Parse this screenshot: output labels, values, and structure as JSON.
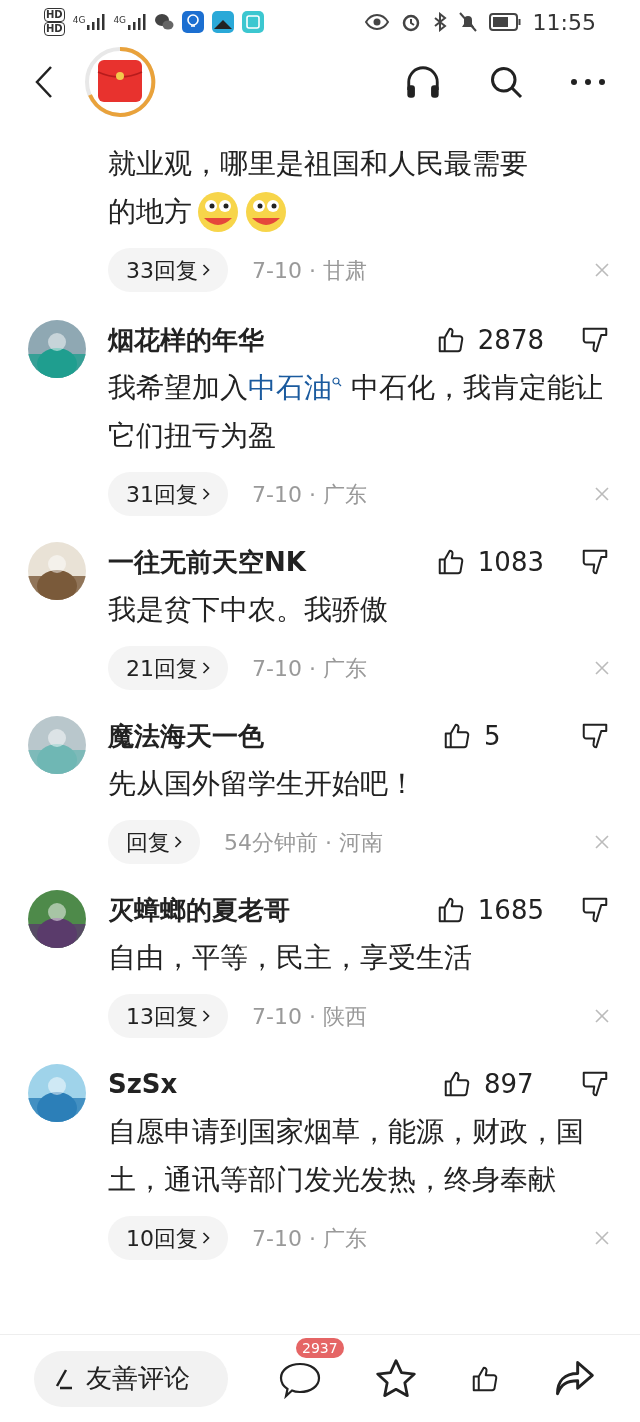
{
  "status_bar": {
    "network": [
      "4G",
      "4G"
    ],
    "sim": [
      "HD",
      "HD"
    ],
    "time": "11:55"
  },
  "top_comment": {
    "lines": [
      "就业观，哪里是祖国和人民最需要",
      "的地方"
    ],
    "emojis": [
      {
        "kind": "emoji"
      },
      {
        "kind": "emoji"
      }
    ],
    "replies": "33回复",
    "meta": "7-10 · 甘肃"
  },
  "comments": [
    {
      "name": "烟花样的年华",
      "likes": "2878",
      "body": [
        {
          "kind": "plain",
          "text": "我希望加入"
        },
        {
          "kind": "link",
          "text": "中石油"
        },
        {
          "kind": "plain",
          "text": " 中石化，我肯定能让它们扭亏为盈"
        }
      ],
      "replies": "31回复",
      "meta": "7-10 · 广东"
    },
    {
      "name": "一往无前天空NK",
      "likes": "1083",
      "body": [
        {
          "kind": "plain",
          "text": "我是贫下中农。我骄傲"
        }
      ],
      "replies": "21回复",
      "meta": "7-10 · 广东"
    },
    {
      "name": "魔法海天一色",
      "likes": "5",
      "body": [
        {
          "kind": "plain",
          "text": "先从国外留学生开始吧！"
        }
      ],
      "replies": "回复",
      "meta": "54分钟前 · 河南"
    },
    {
      "name": "灭蟑螂的夏老哥",
      "likes": "1685",
      "body": [
        {
          "kind": "plain",
          "text": "自由，平等，民主，享受生活"
        }
      ],
      "replies": "13回复",
      "meta": "7-10 · 陕西"
    },
    {
      "name": "SzSx",
      "likes": "897",
      "body": [
        {
          "kind": "plain",
          "text": "自愿申请到国家烟草，能源，财政，国土，通讯等部门发光发热，终身奉献"
        }
      ],
      "replies": "10回复",
      "meta": "7-10 · 广东"
    }
  ],
  "bottom_bar": {
    "input_placeholder": "友善评论",
    "comment_count": "2937"
  }
}
